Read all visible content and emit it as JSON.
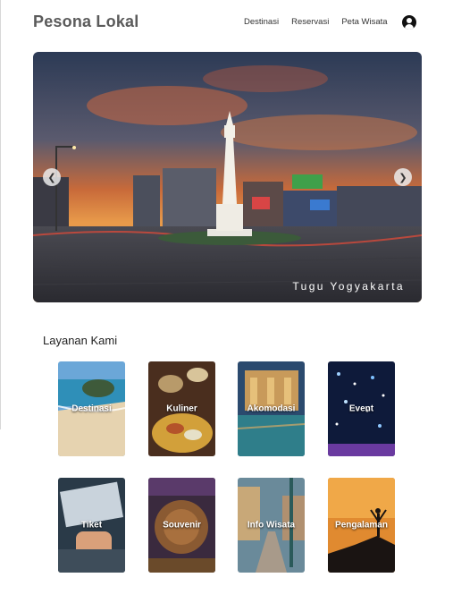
{
  "header": {
    "brand": "Pesona Lokal",
    "nav": [
      "Destinasi",
      "Reservasi",
      "Peta Wisata"
    ],
    "user_icon": "user-circle-icon"
  },
  "hero": {
    "caption": "Tugu Yogyakarta",
    "prev_icon": "chevron-left-icon",
    "next_icon": "chevron-right-icon"
  },
  "services": {
    "title": "Layanan Kami",
    "items": [
      {
        "label": "Destinasi"
      },
      {
        "label": "Kuliner"
      },
      {
        "label": "Akomodasi"
      },
      {
        "label": "Event"
      },
      {
        "label": "Tiket"
      },
      {
        "label": "Souvenir"
      },
      {
        "label": "Info Wisata"
      },
      {
        "label": "Pengalaman"
      }
    ]
  }
}
